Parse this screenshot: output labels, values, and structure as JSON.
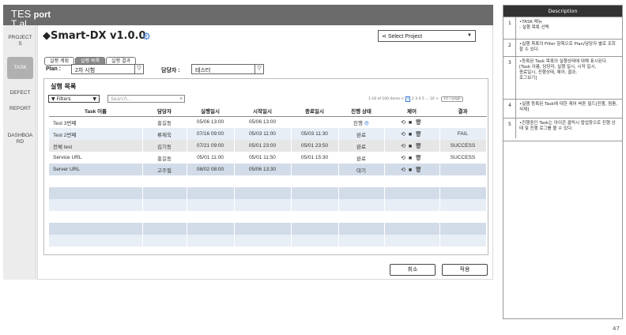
{
  "header": {
    "logo_line1": "TES",
    "logo_port": "port",
    "logo_line2": "T  al"
  },
  "sidebar": {
    "items": [
      {
        "label": "PROJECTS"
      },
      {
        "label": "TASK"
      },
      {
        "label": "DEFECT"
      },
      {
        "label": "REPORT"
      },
      {
        "label": "DASHBOARD"
      }
    ]
  },
  "main": {
    "app_title": "◆Smart-DX v1.0.0",
    "project_select": "Select Project",
    "subtabs": [
      "실행 계획",
      "실행 목록",
      "실행 결과"
    ],
    "plan_label": "Plan :",
    "plan_value": "2차 시험",
    "owner_label": "담당자 :",
    "owner_value": "테스터"
  },
  "panel": {
    "title": "실행 목록",
    "filters_label": "Filters",
    "search_placeholder": "Search...",
    "pager_text": "1-10 of 100 items",
    "pager_pages": [
      "1",
      "2",
      "3",
      "4",
      "5",
      "...",
      "10",
      ">"
    ],
    "per_page": "10 / page"
  },
  "table": {
    "columns": [
      "Task 이름",
      "담당자",
      "실행일시",
      "시작일시",
      "종료일시",
      "진행 상태",
      "제어",
      "결과"
    ],
    "rows": [
      {
        "name": "Test 3번째",
        "owner": "홍길동",
        "run": "05/06 13:00",
        "start": "05/06 13:00",
        "end": "",
        "status": "진행",
        "result": ""
      },
      {
        "name": "Test 2번째",
        "owner": "류제욱",
        "run": "07/16 09:00",
        "start": "05/03 11:00",
        "end": "05/03 11:30",
        "status": "완료",
        "result": "FAIL"
      },
      {
        "name": "전체 test",
        "owner": "김기동",
        "run": "07/21 09:00",
        "start": "05/01 23:00",
        "end": "05/01 23:50",
        "status": "완료",
        "result": "SUCCESS"
      },
      {
        "name": "Service URL",
        "owner": "홍길동",
        "run": "05/01 11:00",
        "start": "05/01 11:50",
        "end": "05/01 15:30",
        "status": "완료",
        "result": "SUCCESS"
      },
      {
        "name": "Server URL",
        "owner": "고주필",
        "run": "08/02 08:00",
        "start": "05/06 13:30",
        "end": "",
        "status": "대기",
        "result": ""
      }
    ],
    "control_icons": "⟲ ■ 🗑"
  },
  "buttons": {
    "cancel": "취소",
    "apply": "적용"
  },
  "description": {
    "title": "Description",
    "rows": [
      {
        "num": "1",
        "text": "•TASK 메뉴\n - 실행 목록 선택"
      },
      {
        "num": "2",
        "text": "•실행 목록의 Filter 항목으로 Plan/담당자 별로 조회 할 수 있다."
      },
      {
        "num": "3",
        "text": "•등록된 Task 목록의 실행상태에 대해 표시된다.\n[Task 이름, 담당자, 실행 일시, 시작 일시,\n종료일시, 진행상태, 제어, 결과,\n로그보기]"
      },
      {
        "num": "4",
        "text": "•실행 등록된 Task에 대한 제어 버튼 필드[진행, 멈춤, 삭제]"
      },
      {
        "num": "5",
        "text": "•진행중인 Task는 아이콘 클릭시 팝업창으로 진행 상태 및 진행 로그를 볼 수 있다."
      }
    ]
  },
  "page_number": "47",
  "colors": {
    "accent": "#3a7bd5",
    "header": "#6b6b6b"
  }
}
